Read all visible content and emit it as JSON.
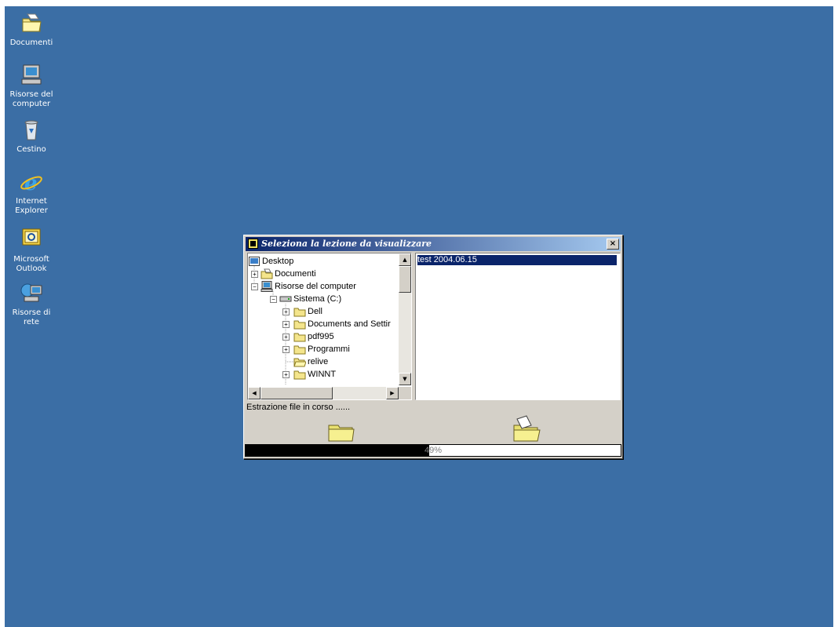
{
  "desktop": {
    "background_color": "#3b6ea5",
    "icons": [
      {
        "label": "Documenti",
        "icon": "folder-documents-icon"
      },
      {
        "label": "Risorse del computer",
        "icon": "my-computer-icon"
      },
      {
        "label": "Cestino",
        "icon": "recycle-bin-icon"
      },
      {
        "label": "Internet Explorer",
        "icon": "internet-explorer-icon"
      },
      {
        "label": "Microsoft Outlook",
        "icon": "outlook-icon"
      },
      {
        "label": "Risorse di rete",
        "icon": "network-places-icon"
      }
    ]
  },
  "dialog": {
    "title": "Seleziona la lezione da visualizzare",
    "close_label": "×",
    "tree": {
      "items": [
        {
          "label": "Desktop",
          "icon": "desktop-icon"
        },
        {
          "label": "Documenti",
          "icon": "folder-documents-icon",
          "expander": "+"
        },
        {
          "label": "Risorse del computer",
          "icon": "my-computer-icon",
          "expander": "−"
        },
        {
          "label": "Sistema (C:)",
          "icon": "drive-icon",
          "expander": "−"
        },
        {
          "label": "Dell",
          "icon": "folder-icon",
          "expander": "+"
        },
        {
          "label": "Documents and Settir",
          "icon": "folder-icon",
          "expander": "+"
        },
        {
          "label": "pdf995",
          "icon": "folder-icon",
          "expander": "+"
        },
        {
          "label": "Programmi",
          "icon": "folder-icon",
          "expander": "+"
        },
        {
          "label": "relive",
          "icon": "folder-open-icon"
        },
        {
          "label": "WINNT",
          "icon": "folder-icon",
          "expander": "+"
        }
      ]
    },
    "list": {
      "items": [
        {
          "label": "test 2004.06.15",
          "selected": true
        }
      ]
    },
    "status_text": "Estrazione file in corso ......",
    "animation": {
      "source_icon": "folder-icon",
      "target_icon": "folder-open-icon"
    },
    "progress": {
      "percent": 49,
      "label": "49%"
    }
  }
}
